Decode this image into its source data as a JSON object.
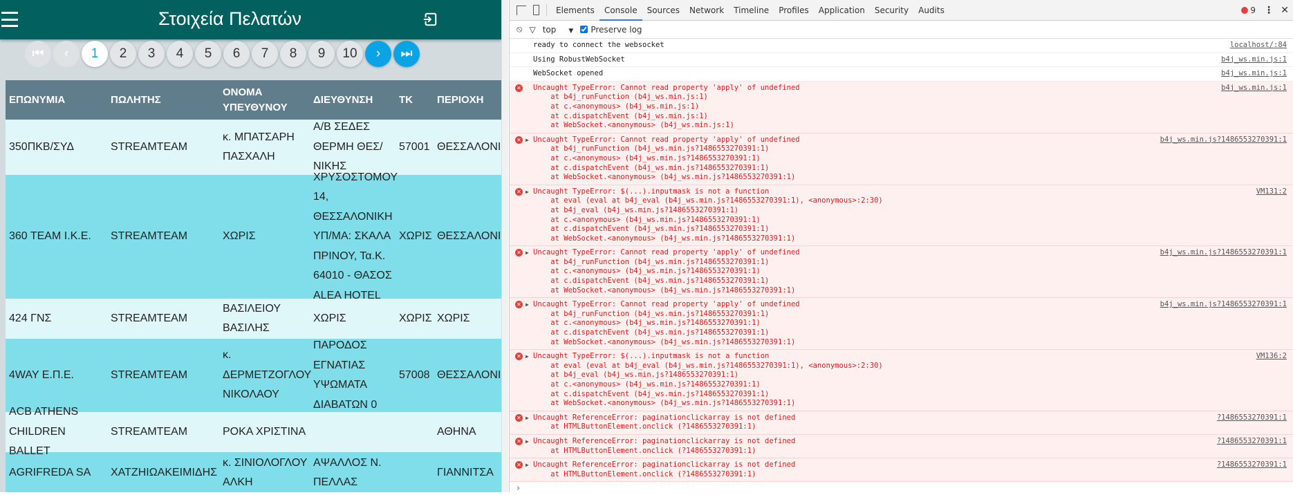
{
  "app": {
    "title": "Στοιχεία Πελατών",
    "pagination": {
      "pages": [
        "1",
        "2",
        "3",
        "4",
        "5",
        "6",
        "7",
        "8",
        "9",
        "10"
      ],
      "current": "1",
      "first": "⏮",
      "prev": "‹",
      "next": "›",
      "last": "⏭"
    },
    "table": {
      "headers": [
        "ΕΠΩΝΥΜΙΑ",
        "ΠΩΛΗΤΗΣ",
        "ΟΝΟΜΑ ΥΠΕΥΘΥΝΟΥ",
        "ΔΙΕΥΘΥΝΣΗ",
        "ΤΚ",
        "ΠΕΡΙΟΧΗ"
      ],
      "rows": [
        [
          "350ΠΚΒ/ΣΥΔ",
          "STREAMTEAM",
          "κ. ΜΠΑΤΣΑΡΗ ΠΑΣΧΑΛΗ",
          "Α/Β ΣΕΔΕΣ ΘΕΡΜΗ ΘΕΣ/ΝΙΚΗΣ",
          "57001",
          "ΘΕΣΣΑΛΟΝΙΚΗ"
        ],
        [
          "360 TEAM I.K.E.",
          "STREAMTEAM",
          "ΧΩΡΙΣ",
          "ΧΡΥΣΟΣΤΟΜΟΥ 14, ΘΕΣΣΑΛΟΝΙΚΗ ΥΠ/ΜΑ: ΣΚΑΛΑ ΠΡΙΝΟΥ, Τα.Κ. 64010 - ΘΑΣΟΣ ALEA HOTEL",
          "ΧΩΡΙΣ",
          "ΘΕΣΣΑΛΟΝΙΚΗ"
        ],
        [
          "424 ΓΝΣ",
          "STREAMTEAM",
          "ΒΑΣΙΛΕΙΟΥ ΒΑΣΙΛΗΣ",
          "ΧΩΡΙΣ",
          "ΧΩΡΙΣ",
          "ΧΩΡΙΣ"
        ],
        [
          "4WAY Ε.Π.Ε.",
          "STREAMTEAM",
          "κ. ΔΕΡΜΕΤΖΟΓΛΟΥ ΝΙΚΟΛΑΟΥ",
          "ΠΑΡΟΔΟΣ ΕΓΝΑΤΙΑΣ ΥΨΩΜΑΤΑ ΔΙΑΒΑΤΩΝ 0",
          "57008",
          "ΘΕΣΣΑΛΟΝΙΚΗ"
        ],
        [
          "ACB ATHENS CHILDREN BALLET",
          "STREAMTEAM",
          "ΡΟΚΑ ΧΡΙΣΤΙΝΑ",
          "",
          "",
          "ΑΘΗΝΑ"
        ],
        [
          "AGRIFREDA SA",
          "ΧΑΤΖΗΙΩΑΚΕΙΜΙΔΗΣ",
          "κ. ΣΙΝΙΟΛΟΓΛΟΥ ΑΛΚΗ",
          "ΑΨΑΛΛΟΣ Ν. ΠΕΛΛΑΣ",
          "",
          "ΓΙΑΝΝΙΤΣΑ"
        ]
      ]
    }
  },
  "devtools": {
    "tabs": [
      "Elements",
      "Console",
      "Sources",
      "Network",
      "Timeline",
      "Profiles",
      "Application",
      "Security",
      "Audits"
    ],
    "active_tab": "Console",
    "error_count": "9",
    "filter": {
      "context": "top",
      "preserve_log": "Preserve log"
    },
    "messages": [
      {
        "type": "log",
        "text": [
          "ready to connect the websocket"
        ],
        "source": "localhost/:84"
      },
      {
        "type": "log",
        "text": [
          "Using RobustWebSocket"
        ],
        "source": "b4j_ws.min.js:1"
      },
      {
        "type": "log",
        "text": [
          "WebSocket opened"
        ],
        "source": "b4j_ws.min.js:1"
      },
      {
        "type": "error",
        "expand": false,
        "text": [
          "Uncaught TypeError: Cannot read property 'apply' of undefined",
          "    at b4j_runFunction (b4j_ws.min.js:1)",
          "    at c.<anonymous> (b4j_ws.min.js:1)",
          "    at c.dispatchEvent (b4j_ws.min.js:1)",
          "    at WebSocket.<anonymous> (b4j_ws.min.js:1)"
        ],
        "source": "b4j_ws.min.js:1"
      },
      {
        "type": "error",
        "expand": true,
        "text": [
          "Uncaught TypeError: Cannot read property 'apply' of undefined",
          "    at b4j_runFunction (b4j_ws.min.js?1486553270391:1)",
          "    at c.<anonymous> (b4j_ws.min.js?1486553270391:1)",
          "    at c.dispatchEvent (b4j_ws.min.js?1486553270391:1)",
          "    at WebSocket.<anonymous> (b4j_ws.min.js?1486553270391:1)"
        ],
        "source": "b4j_ws.min.js?1486553270391:1"
      },
      {
        "type": "error",
        "expand": true,
        "text": [
          "Uncaught TypeError: $(...).inputmask is not a function",
          "    at eval (eval at b4j_eval (b4j_ws.min.js?1486553270391:1), <anonymous>:2:30)",
          "    at b4j_eval (b4j_ws.min.js?1486553270391:1)",
          "    at c.<anonymous> (b4j_ws.min.js?1486553270391:1)",
          "    at c.dispatchEvent (b4j_ws.min.js?1486553270391:1)",
          "    at WebSocket.<anonymous> (b4j_ws.min.js?1486553270391:1)"
        ],
        "source": "VM131:2"
      },
      {
        "type": "error",
        "expand": true,
        "text": [
          "Uncaught TypeError: Cannot read property 'apply' of undefined",
          "    at b4j_runFunction (b4j_ws.min.js?1486553270391:1)",
          "    at c.<anonymous> (b4j_ws.min.js?1486553270391:1)",
          "    at c.dispatchEvent (b4j_ws.min.js?1486553270391:1)",
          "    at WebSocket.<anonymous> (b4j_ws.min.js?1486553270391:1)"
        ],
        "source": "b4j_ws.min.js?1486553270391:1"
      },
      {
        "type": "error",
        "expand": true,
        "text": [
          "Uncaught TypeError: Cannot read property 'apply' of undefined",
          "    at b4j_runFunction (b4j_ws.min.js?1486553270391:1)",
          "    at c.<anonymous> (b4j_ws.min.js?1486553270391:1)",
          "    at c.dispatchEvent (b4j_ws.min.js?1486553270391:1)",
          "    at WebSocket.<anonymous> (b4j_ws.min.js?1486553270391:1)"
        ],
        "source": "b4j_ws.min.js?1486553270391:1"
      },
      {
        "type": "error",
        "expand": true,
        "text": [
          "Uncaught TypeError: $(...).inputmask is not a function",
          "    at eval (eval at b4j_eval (b4j_ws.min.js?1486553270391:1), <anonymous>:2:30)",
          "    at b4j_eval (b4j_ws.min.js?1486553270391:1)",
          "    at c.<anonymous> (b4j_ws.min.js?1486553270391:1)",
          "    at c.dispatchEvent (b4j_ws.min.js?1486553270391:1)",
          "    at WebSocket.<anonymous> (b4j_ws.min.js?1486553270391:1)"
        ],
        "source": "VM136:2"
      },
      {
        "type": "error",
        "expand": true,
        "text": [
          "Uncaught ReferenceError: paginationclickarray is not defined",
          "    at HTMLButtonElement.onclick (?1486553270391:1)"
        ],
        "source": "?1486553270391:1"
      },
      {
        "type": "error",
        "expand": true,
        "text": [
          "Uncaught ReferenceError: paginationclickarray is not defined",
          "    at HTMLButtonElement.onclick (?1486553270391:1)"
        ],
        "source": "?1486553270391:1"
      },
      {
        "type": "error",
        "expand": true,
        "text": [
          "Uncaught ReferenceError: paginationclickarray is not defined",
          "    at HTMLButtonElement.onclick (?1486553270391:1)"
        ],
        "source": "?1486553270391:1"
      }
    ],
    "prompt": "›"
  }
}
